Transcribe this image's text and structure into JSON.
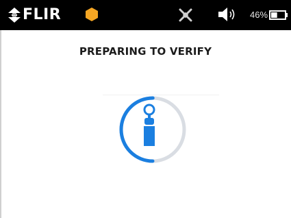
{
  "statusbar": {
    "brand": "FLIR",
    "battery_percent": "46%",
    "battery_level": 0.46,
    "icons": [
      "flir-logo-icon",
      "hexagon-status-icon",
      "satellite-off-icon",
      "speaker-icon",
      "battery-icon"
    ],
    "colors": {
      "background": "#000000",
      "hexagon": "#f5a623"
    }
  },
  "main": {
    "title": "PREPARING TO VERIFY",
    "spinner": {
      "icon": "gas-cylinder-icon",
      "progress": 0.5,
      "colors": {
        "arc": "#1b7fe0",
        "track": "#d9dde3",
        "icon": "#1b7fe0"
      }
    }
  }
}
